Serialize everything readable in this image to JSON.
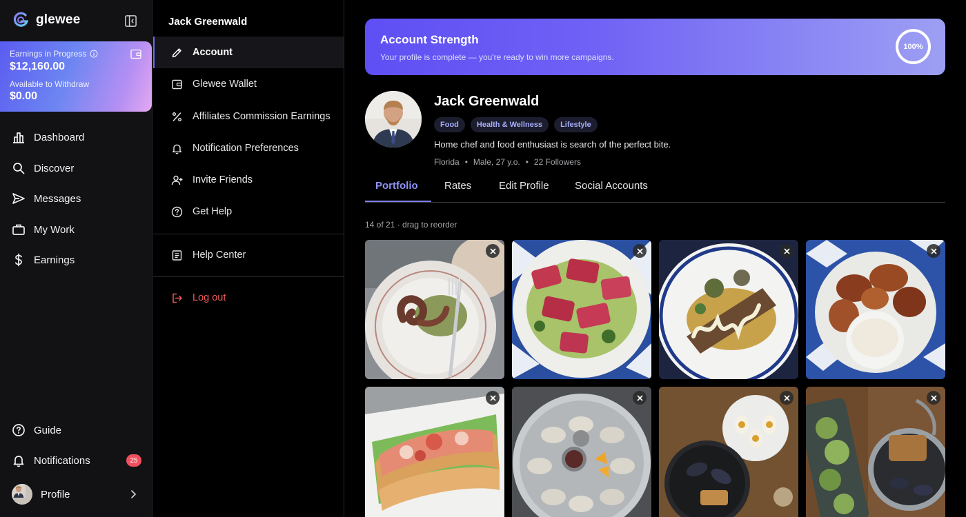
{
  "brand": {
    "name": "glewee"
  },
  "earnings_card": {
    "in_progress_label": "Earnings in Progress",
    "in_progress_value": "$12,160.00",
    "withdraw_label": "Available to Withdraw",
    "withdraw_value": "$0.00"
  },
  "nav": {
    "items": [
      {
        "label": "Dashboard",
        "icon": "bar-chart-icon"
      },
      {
        "label": "Discover",
        "icon": "search-icon"
      },
      {
        "label": "Messages",
        "icon": "send-icon"
      },
      {
        "label": "My Work",
        "icon": "briefcase-icon"
      },
      {
        "label": "Earnings",
        "icon": "dollar-icon"
      }
    ],
    "bottom": {
      "guide": "Guide",
      "notifications": "Notifications",
      "notifications_count": "25",
      "profile": "Profile"
    }
  },
  "settings": {
    "title": "Jack Greenwald",
    "items": [
      {
        "label": "Account",
        "icon": "pencil-icon",
        "active": true
      },
      {
        "label": "Glewee Wallet",
        "icon": "wallet-icon"
      },
      {
        "label": "Affiliates Commission Earnings",
        "icon": "percent-icon"
      },
      {
        "label": "Notification Preferences",
        "icon": "bell-icon"
      },
      {
        "label": "Invite Friends",
        "icon": "user-plus-icon"
      },
      {
        "label": "Get Help",
        "icon": "help-circle-icon"
      }
    ],
    "help_center": "Help Center",
    "logout": "Log out",
    "logout_color": "#f05a5a"
  },
  "strength": {
    "title": "Account Strength",
    "subtitle": "Your profile is complete — you're ready to win more campaigns.",
    "percent_label": "100%",
    "percent": 100
  },
  "profile": {
    "name": "Jack Greenwald",
    "tags": [
      "Food",
      "Health & Wellness",
      "Lifestyle"
    ],
    "bio": "Home chef and food enthusiast is search of the perfect bite.",
    "location": "Florida",
    "demographics": "Male, 27 y.o.",
    "followers": "22 Followers"
  },
  "tabs": [
    "Portfolio",
    "Rates",
    "Edit Profile",
    "Social Accounts"
  ],
  "active_tab": "Portfolio",
  "portfolio": {
    "count_label": "14 of 21 · drag to reorder",
    "photos": [
      {
        "subject": "grilled-octopus-plate"
      },
      {
        "subject": "tuna-crudo-plate"
      },
      {
        "subject": "fish-with-sauce-plate"
      },
      {
        "subject": "fried-potatoes-with-dip"
      },
      {
        "subject": "lobster-roll"
      },
      {
        "subject": "oysters-on-ice"
      },
      {
        "subject": "mussels-and-deviled-eggs"
      },
      {
        "subject": "salad-and-mussels"
      }
    ]
  },
  "accent_color": "#6b6cf5"
}
